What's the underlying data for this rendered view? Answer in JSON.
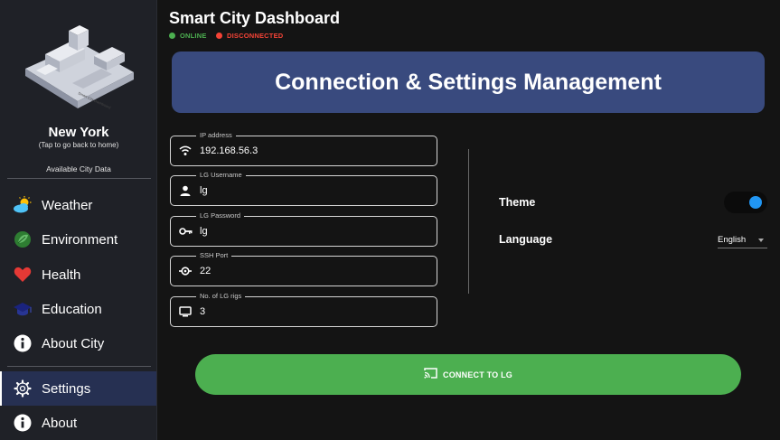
{
  "app": {
    "title": "Smart City Dashboard"
  },
  "status": [
    {
      "label": "ONLINE",
      "color": "#4caf50"
    },
    {
      "label": "DISCONNECTED",
      "color": "#f44336"
    }
  ],
  "sidebar": {
    "city_name": "New York",
    "city_hint": "(Tap to go back to home)",
    "section_title": "Available City Data",
    "items": [
      {
        "label": "Weather",
        "icon": "weather-icon"
      },
      {
        "label": "Environment",
        "icon": "environment-icon"
      },
      {
        "label": "Health",
        "icon": "heart-icon"
      },
      {
        "label": "Education",
        "icon": "education-icon"
      },
      {
        "label": "About City",
        "icon": "info-icon"
      }
    ],
    "bottom_items": [
      {
        "label": "Settings",
        "icon": "gear-icon",
        "active": true
      },
      {
        "label": "About",
        "icon": "info-icon",
        "active": false
      }
    ]
  },
  "banner": {
    "title": "Connection & Settings Management"
  },
  "fields": [
    {
      "label": "IP address",
      "value": "192.168.56.3",
      "icon": "wifi-icon"
    },
    {
      "label": "LG Username",
      "value": "lg",
      "icon": "person-icon"
    },
    {
      "label": "LG Password",
      "value": "lg",
      "icon": "key-icon"
    },
    {
      "label": "SSH Port",
      "value": "22",
      "icon": "port-icon"
    },
    {
      "label": "No. of LG rigs",
      "value": "3",
      "icon": "monitor-icon"
    }
  ],
  "settings": {
    "theme_label": "Theme",
    "theme_enabled": true,
    "language_label": "Language",
    "language_value": "English"
  },
  "connect": {
    "label": "CONNECT TO LG",
    "icon": "cast-icon"
  }
}
